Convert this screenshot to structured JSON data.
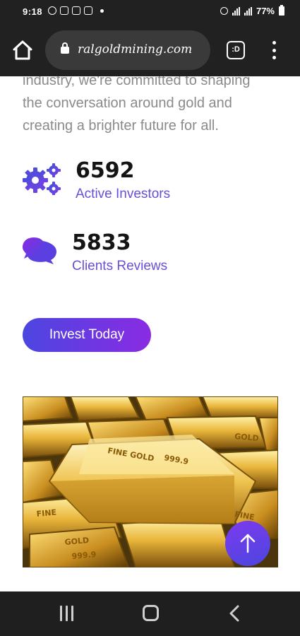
{
  "status_bar": {
    "time": "9:18",
    "battery": "77%"
  },
  "browser": {
    "url": "ralgoldmining.com"
  },
  "intro": {
    "line1": "industry, we're committed to shaping",
    "line2": "the conversation around gold and",
    "line3": "creating a brighter future for all."
  },
  "stats": [
    {
      "value": "6592",
      "label": "Active Investors",
      "icon": "gears-icon"
    },
    {
      "value": "5833",
      "label": "Clients Reviews",
      "icon": "chat-bubbles-icon"
    }
  ],
  "cta": {
    "label": "Invest Today"
  },
  "image": {
    "subject": "stacked gold bars",
    "bar_text": "FINE GOLD 999.9"
  },
  "colors": {
    "accent_purple": "#6a4ed6",
    "gradient_start": "#4c46e0",
    "gradient_end": "#8a2be2",
    "chrome_dark": "#212121"
  }
}
